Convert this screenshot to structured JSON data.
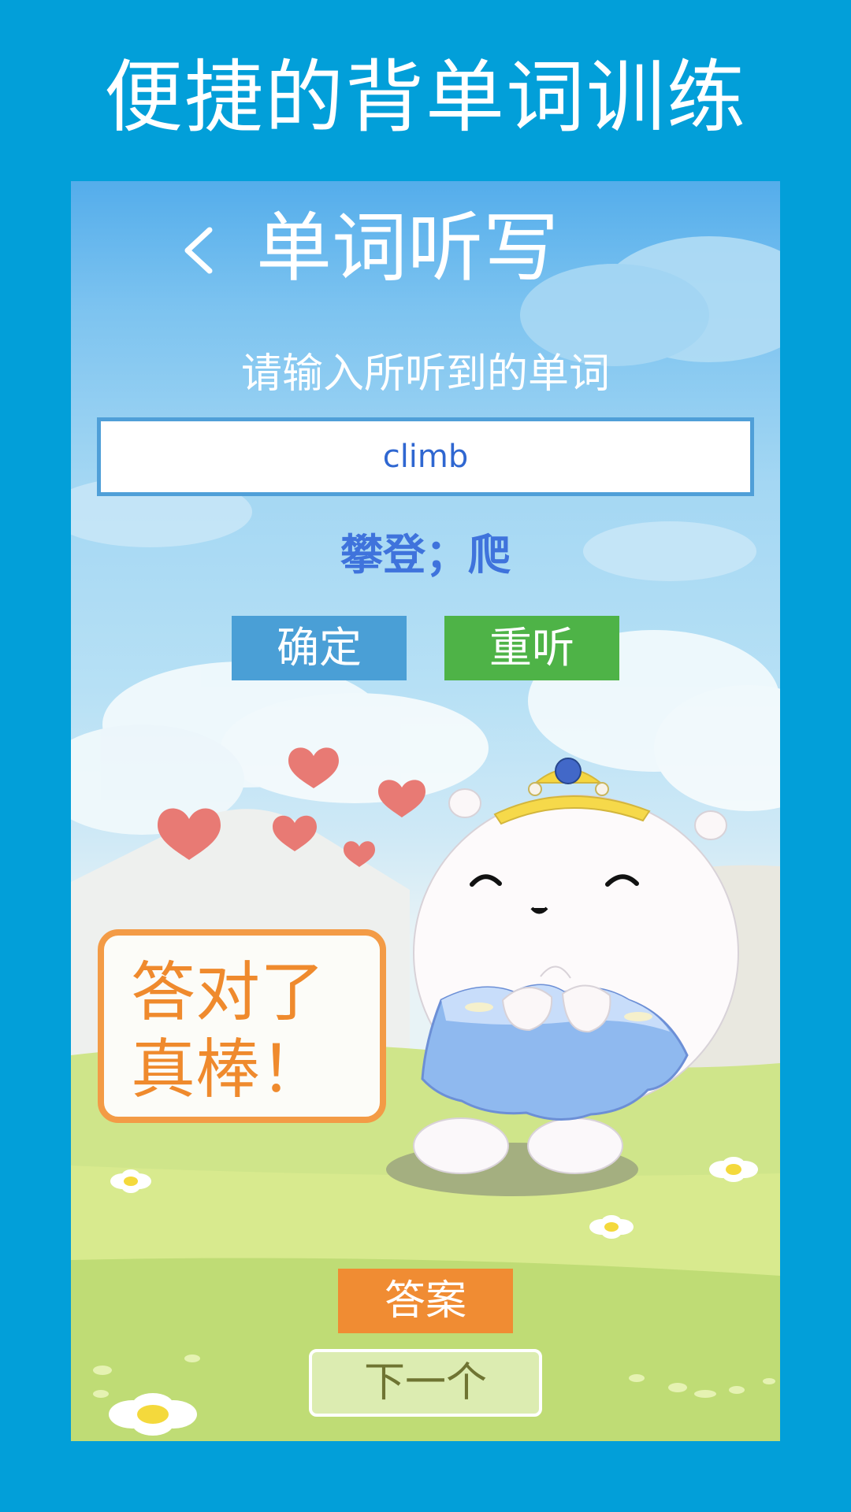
{
  "promo": {
    "title": "便捷的背单词训练"
  },
  "screen": {
    "title": "单词听写",
    "prompt": "请输入所听到的单词",
    "input_value": "climb",
    "meaning": "攀登；爬",
    "confirm_label": "确定",
    "replay_label": "重听",
    "feedback_line1": "答对了",
    "feedback_line2": "真棒！",
    "answer_label": "答案",
    "next_label": "下一个"
  },
  "icons": {
    "back": "chevron-left-icon",
    "mascot": "mascot-illustration"
  },
  "colors": {
    "outer_bg": "#029fd9",
    "confirm": "#4a9fd6",
    "replay": "#4eb347",
    "answer": "#f08c33",
    "next": "#dcecb1",
    "feedback_border": "#f39b46",
    "feedback_text": "#ef8a2d",
    "meaning": "#3f73dc",
    "input_text": "#2f67d1"
  }
}
